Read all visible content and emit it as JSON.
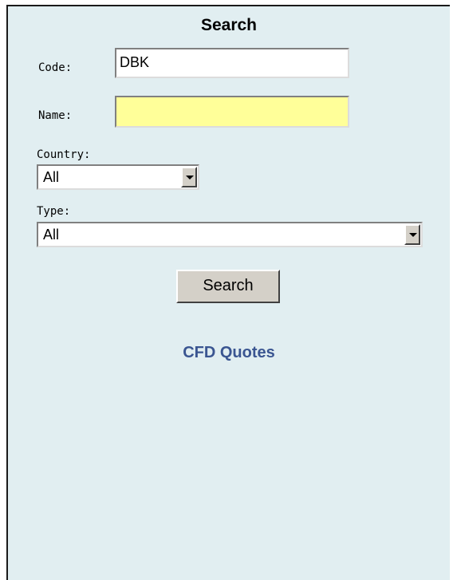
{
  "search": {
    "title": "Search",
    "code": {
      "label": "Code:",
      "value": "DBK"
    },
    "name": {
      "label": "Name:",
      "value": "",
      "highlight_color": "#ffff99"
    },
    "country": {
      "label": "Country:",
      "selected": "All"
    },
    "type": {
      "label": "Type:",
      "selected": "All"
    },
    "search_button": "Search",
    "link_text": "CFD Quotes"
  },
  "colors": {
    "panel_background": "#e1eef1",
    "link": "#3a5591",
    "button_face": "#d4d0c8"
  }
}
